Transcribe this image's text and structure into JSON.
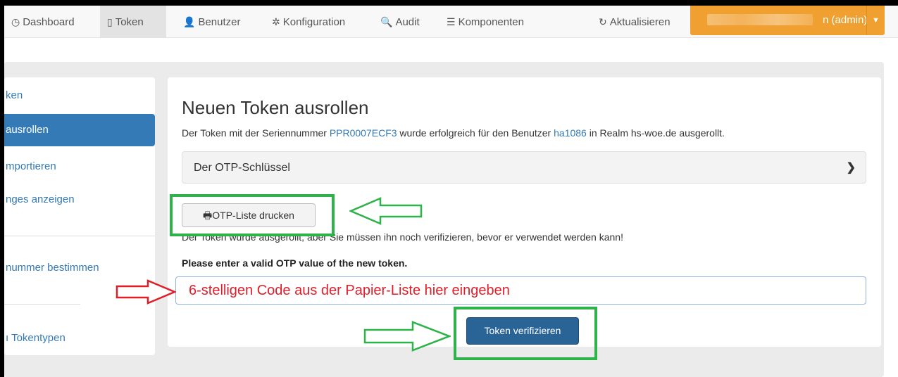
{
  "navbar": {
    "items": [
      {
        "label": "Dashboard",
        "icon": "clock-icon"
      },
      {
        "label": "Token",
        "icon": "tablet-icon",
        "active": true
      },
      {
        "label": "Benutzer",
        "icon": "user-icon"
      },
      {
        "label": "Konfiguration",
        "icon": "gear-icon"
      },
      {
        "label": "Audit",
        "icon": "search-icon"
      },
      {
        "label": "Komponenten",
        "icon": "list-icon"
      }
    ],
    "refresh_label": "Aktualisieren",
    "user_suffix": "n (admin)",
    "accent_color": "#f0a030"
  },
  "sidebar": {
    "items": [
      {
        "label": "ken"
      },
      {
        "label": "ausrollen",
        "active": true
      },
      {
        "label": "mportieren"
      },
      {
        "label": "nges anzeigen"
      },
      {
        "label": "nummer bestimmen"
      },
      {
        "label": "ı Tokentypen"
      }
    ]
  },
  "main": {
    "title": "Neuen Token ausrollen",
    "msg_pre": "Der Token mit der Seriennummer ",
    "serial": "PPR0007ECF3",
    "msg_mid": " wurde erfolgreich für den Benutzer ",
    "user": "ha1086",
    "msg_post": " in Realm hs-woe.de ausgerollt.",
    "accordion_label": "Der OTP-Schlüssel",
    "print_button": "OTP-Liste drucken",
    "warning": "Der Token wurde ausgerollt, aber Sie müssen ihn noch verifizieren, bevor er verwendet werden kann!",
    "prompt": "Please enter a valid OTP value of the new token.",
    "otp_input": {
      "value": "",
      "placeholder": "6-stelligen Code aus der Papier-Liste hier eingeben"
    },
    "verify_button": "Token verifizieren"
  },
  "annotation_colors": {
    "highlight": "#2db34a",
    "red_arrow": "#e01e2a"
  }
}
